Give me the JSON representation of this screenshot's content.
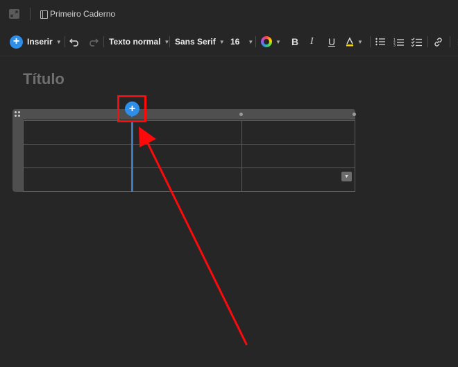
{
  "header": {
    "notebook_title": "Primeiro Caderno"
  },
  "toolbar": {
    "insert_label": "Inserir",
    "text_style": "Texto normal",
    "font_family": "Sans Serif",
    "font_size": "16",
    "bold": "B",
    "italic": "I",
    "underline": "U"
  },
  "document": {
    "title_placeholder": "Título"
  },
  "table": {
    "rows": 3,
    "columns": 3,
    "add_column_button": "+"
  },
  "colors": {
    "accent": "#2f8fe8",
    "annotation": "#ff0a0a",
    "background": "#262626"
  }
}
